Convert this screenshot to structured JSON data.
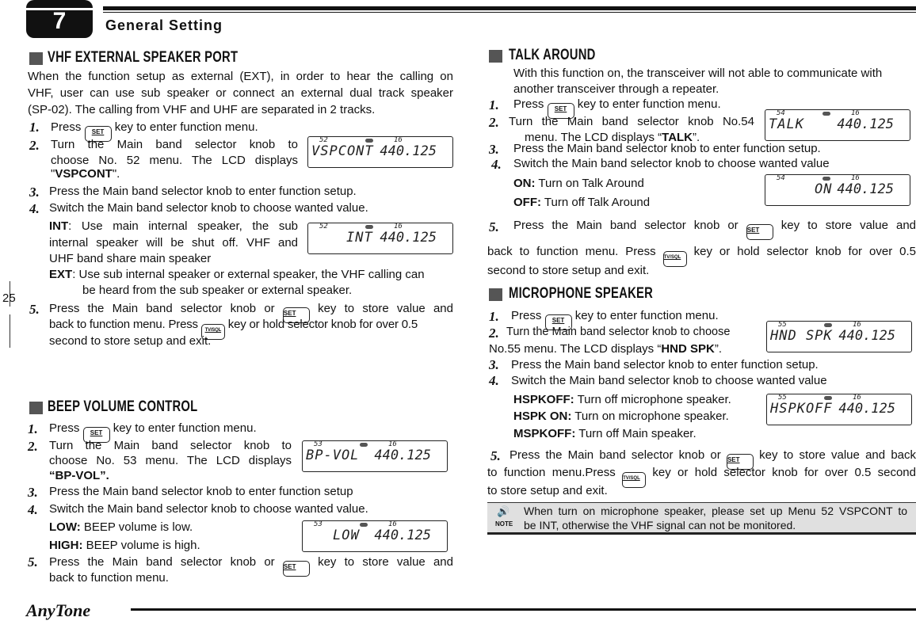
{
  "header": {
    "chapter": "7",
    "title": "General Setting"
  },
  "page_number": "25",
  "keys": {
    "set": "SET",
    "tvsql": "TV/SQL"
  },
  "vhf": {
    "title": "VHF EXTERNAL SPEAKER PORT",
    "intro": [
      "When the function setup as external (EXT), in order to hear the calling on",
      "VHF, user can use sub speaker or connect an external dual track speaker",
      "(SP-02). The calling from VHF and UHF are separated in 2 tracks."
    ],
    "s1n": "1.",
    "s1a": "Press",
    "s1b": "key to enter function menu.",
    "s2n": "2.",
    "s2a": "Turn the Main band selector knob to",
    "s2b": "choose No. 52 menu. The LCD displays",
    "s2c": "\"",
    "s2d": "VSPCONT",
    "s2e": "\".",
    "s3n": "3.",
    "s3": "Press the Main band selector knob to enter function setup.",
    "s4n": "4.",
    "s4": "Switch the Main band selector knob to choose wanted value.",
    "int_l": "INT",
    "int_1": ": Use main internal speaker, the sub",
    "int_2": "internal speaker will be shut off. VHF and",
    "int_3": "UHF band share main speaker",
    "ext_l": "EXT",
    "ext_1": ": Use sub internal speaker or external speaker, the VHF calling can",
    "ext_2": "be heard from the sub speaker or external speaker.",
    "s5n": "5.",
    "s5a": "Press the Main band selector knob or",
    "s5b": "key to store value and",
    "s5c": "back to function menu. Press",
    "s5d": "key or hold selector knob for over 0.5",
    "s5e": "second to store setup and exit.",
    "lcd1": {
      "num": "52",
      "ch": "16",
      "text": "VSPCONT",
      "freq": "440.125"
    },
    "lcd2": {
      "num": "52",
      "ch": "16",
      "text": "INT",
      "freq": "440.125"
    }
  },
  "beep": {
    "title": "BEEP VOLUME CONTROL",
    "s1n": "1.",
    "s1a": "Press",
    "s1b": "key to enter function menu.",
    "s2n": "2.",
    "s2a": "Turn the Main band selector knob to",
    "s2b": "choose No. 53 menu. The LCD displays",
    "s2c": "“BP-VOL”.",
    "s3n": "3.",
    "s3": "Press the Main band selector knob to enter function setup",
    "s4n": "4.",
    "s4": "Switch the Main band selector knob to choose wanted value.",
    "low_l": "LOW:",
    "low": " BEEP volume is low.",
    "high_l": "HIGH:",
    "high": " BEEP volume is high.",
    "s5n": "5.",
    "s5a": "Press the Main band selector knob or",
    "s5b": "key to store value and",
    "s5c": "back to function menu.",
    "lcd1": {
      "num": "53",
      "ch": "16",
      "text": "BP-VOL",
      "freq": "440.125"
    },
    "lcd2": {
      "num": "53",
      "ch": "16",
      "text": "LOW",
      "freq": "440.125"
    }
  },
  "talk": {
    "title": "TALK AROUND",
    "intro": [
      "With this function on, the transceiver will not able to communicate with",
      "another transceiver  through a repeater."
    ],
    "s1n": "1.",
    "s1a": "Press",
    "s1b": "key to enter function menu.",
    "s2n": "2.",
    "s2a": "Turn the Main band selector knob No.54",
    "s2b": "menu. The LCD displays “",
    "s2c": "TALK",
    "s2d": "”.",
    "s3n": "3.",
    "s3": "Press the Main band selector knob to enter function setup.",
    "s4n": "4.",
    "s4": "Switch the Main band selector knob to choose wanted value",
    "on_l": "ON:",
    "on": " Turn on Talk Around",
    "off_l": "OFF:",
    "off": " Turn off Talk Around",
    "s5n": "5.",
    "s5a": "Press the Main band selector knob or",
    "s5b": "key to store value and",
    "s5c": "back to function menu. Press",
    "s5d": "key or hold selector knob for over 0.5",
    "s5e": "second to store setup and exit.",
    "lcd1": {
      "num": "54",
      "ch": "16",
      "text": "TALK",
      "freq": "440.125"
    },
    "lcd2": {
      "num": "54",
      "ch": "16",
      "text": "ON",
      "freq": "440.125"
    }
  },
  "mic": {
    "title": "MICROPHONE SPEAKER",
    "s1n": "1.",
    "s1a": "Press",
    "s1b": "key to enter function menu.",
    "s2n": "2.",
    "s2a": "Turn the Main band selector knob to choose",
    "s2b": "No.55 menu. The LCD displays “",
    "s2c": "HND SPK",
    "s2d": "”.",
    "s3n": "3.",
    "s3": "Press the Main band selector knob to enter function setup.",
    "s4n": "4.",
    "s4": "Switch the Main band selector knob to choose wanted value",
    "o1_l": "HSPKOFF:",
    "o1": " Turn off microphone speaker.",
    "o2_l": "HSPK ON:",
    "o2": " Turn on microphone speaker.",
    "o3_l": "MSPKOFF:",
    "o3": " Turn off Main speaker.",
    "s5n": "5.",
    "s5a": "Press the Main band selector knob or",
    "s5b": "key to store value and back",
    "s5c": "to function menu.Press",
    "s5d": "key or hold selector knob for over 0.5 second",
    "s5e": "to store setup and exit.",
    "lcd1": {
      "num": "55",
      "ch": "16",
      "text": "HND SPK",
      "freq": "440.125"
    },
    "lcd2": {
      "num": "55",
      "ch": "16",
      "text": "HSPKOFF",
      "freq": "440.125"
    }
  },
  "note": {
    "label": "NOTE",
    "lines": [
      "When turn on microphone speaker, please set up Menu 52 VSPCONT to",
      "be INT, otherwise the VHF signal can not be monitored."
    ]
  },
  "footer": {
    "logo": "AnyTone"
  }
}
